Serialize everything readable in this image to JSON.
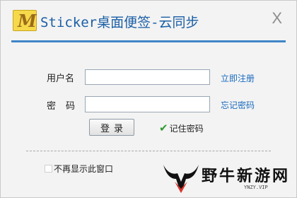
{
  "window": {
    "title": "Sticker桌面便签-云同步",
    "close_icon": "close-icon",
    "accent_color": "#3f86c8",
    "title_color": "#1b5fa6"
  },
  "form": {
    "username_label": "用户名",
    "username_value": "",
    "password_label": "密码",
    "password_value": "",
    "register_link": "立即注册",
    "forgot_link": "忘记密码",
    "login_button": "登录",
    "remember_label": "记住密码",
    "remember_checked": true,
    "dont_show_label": "不再显示此窗口",
    "dont_show_checked": false,
    "link_color": "#1a6bbf"
  },
  "watermark": {
    "text": "野牛新游网",
    "sub": "YNZY.VIP"
  }
}
